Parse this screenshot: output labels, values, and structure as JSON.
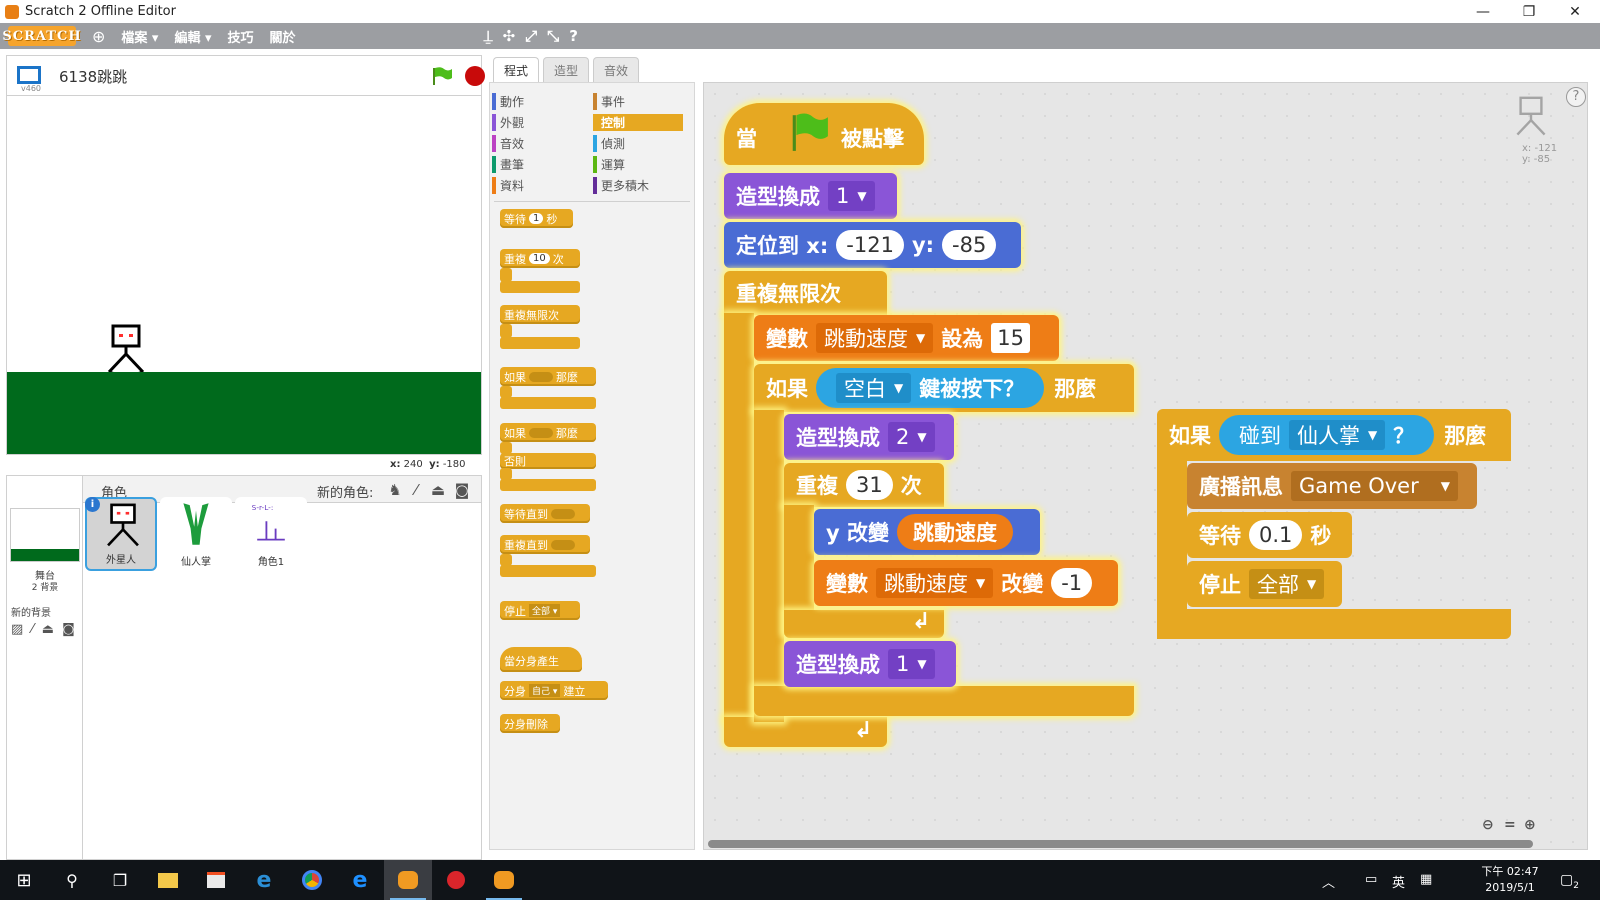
{
  "window": {
    "title": "Scratch 2 Offline Editor",
    "minimize": "—",
    "restore": "❐",
    "close": "✕"
  },
  "menubar": {
    "logo": "SCRATCH",
    "items": [
      "檔案 ▾",
      "編輯 ▾",
      "技巧",
      "關於"
    ],
    "tools": [
      "⍊",
      "✣",
      "⤢",
      "⤡",
      "?"
    ]
  },
  "stage": {
    "version": "v460",
    "project_title": "6138跳跳",
    "coords": {
      "x_label": "x:",
      "x": "240",
      "y_label": "y:",
      "y": "-180"
    },
    "colors": {
      "ground": "#006a1c",
      "alien": "#000000",
      "alien_face": "#ff2e2e"
    }
  },
  "sprite_pane": {
    "label": "角色",
    "new_sprite_label": "新的角色:",
    "stage_label": "舞台",
    "backdrop_count": "2 背景",
    "new_backdrop_label": "新的背景",
    "sprites": [
      {
        "name": "外星人",
        "selected": true
      },
      {
        "name": "仙人掌",
        "selected": false
      },
      {
        "name": "角色1",
        "selected": false
      }
    ]
  },
  "tabs": [
    "程式",
    "造型",
    "音效"
  ],
  "categories": {
    "left": [
      {
        "label": "動作",
        "color": "#4a6cd4"
      },
      {
        "label": "外觀",
        "color": "#8a55d7"
      },
      {
        "label": "音效",
        "color": "#bb42c3"
      },
      {
        "label": "畫筆",
        "color": "#0e9a6c"
      },
      {
        "label": "資料",
        "color": "#ee7d16"
      }
    ],
    "right": [
      {
        "label": "事件",
        "color": "#c88330"
      },
      {
        "label": "控制",
        "color": "#e6a822",
        "active": true
      },
      {
        "label": "偵測",
        "color": "#2ca5e2"
      },
      {
        "label": "運算",
        "color": "#5cb712"
      },
      {
        "label": "更多積木",
        "color": "#632d99"
      }
    ]
  },
  "palette": {
    "wait": {
      "pre": "等待",
      "val": "1",
      "post": "秒"
    },
    "repeat": {
      "pre": "重複",
      "val": "10",
      "post": "次"
    },
    "forever": "重複無限次",
    "if_then": {
      "pre": "如果",
      "post": "那麼"
    },
    "if_else": {
      "pre": "如果",
      "post": "那麼",
      "else": "否則"
    },
    "wait_until": "等待直到",
    "repeat_until": "重複直到",
    "stop": {
      "pre": "停止",
      "val": "全部 ▾"
    },
    "clone_hat": "當分身產生",
    "create_clone": {
      "pre": "分身",
      "val": "自己 ▾",
      "post": "建立"
    },
    "delete_clone": "分身刪除"
  },
  "script_main": {
    "hat": {
      "pre": "當",
      "post": "被點擊"
    },
    "switch_costume": {
      "label": "造型換成",
      "value": "1"
    },
    "goto": {
      "label": "定位到 x:",
      "x": "-121",
      "y_label": "y:",
      "y": "-85"
    },
    "forever": "重複無限次",
    "set_var": {
      "label": "變數",
      "var": "跳動速度",
      "mid": "設為",
      "value": "15"
    },
    "if_key": {
      "pre": "如果",
      "key": "空白",
      "cond": "鍵被按下？",
      "post": "那麼"
    },
    "switch_costume_2": {
      "label": "造型換成",
      "value": "2"
    },
    "repeat": {
      "label": "重複",
      "value": "31",
      "post": "次"
    },
    "change_y": {
      "label": "y 改變",
      "value": "跳動速度"
    },
    "change_var": {
      "label": "變數",
      "var": "跳動速度",
      "mid": "改變",
      "value": "-1"
    },
    "switch_costume_3": {
      "label": "造型換成",
      "value": "1"
    }
  },
  "script_side": {
    "if_touch": {
      "pre": "如果",
      "cond": "碰到",
      "target": "仙人掌",
      "q": "？",
      "post": "那麼"
    },
    "broadcast": {
      "label": "廣播訊息",
      "value": "Game Over"
    },
    "wait": {
      "label": "等待",
      "value": "0.1",
      "post": "秒"
    },
    "stop": {
      "label": "停止",
      "value": "全部"
    }
  },
  "script_area": {
    "ghost_coords": {
      "x": "x: -121",
      "y": "y: -85"
    }
  },
  "taskbar": {
    "clock_time": "下午 02:47",
    "clock_date": "2019/5/1",
    "ime": "英",
    "notif_count": "2"
  }
}
